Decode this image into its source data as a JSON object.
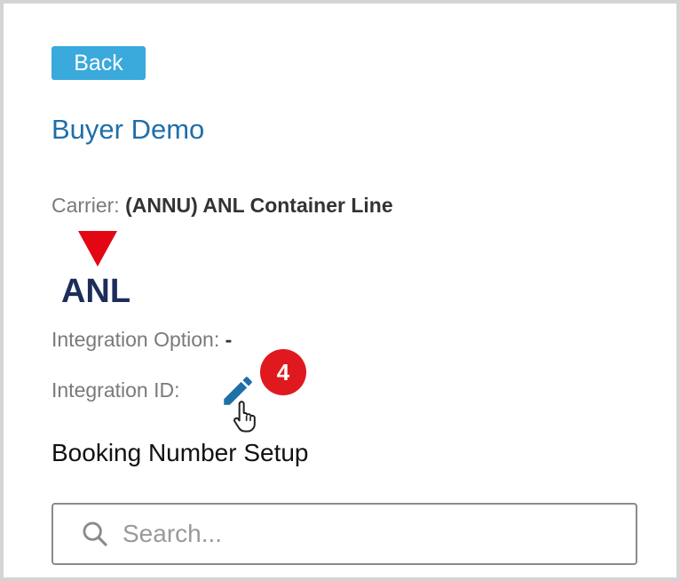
{
  "nav": {
    "back_label": "Back"
  },
  "header": {
    "title": "Buyer Demo"
  },
  "carrier": {
    "label": "Carrier:",
    "value": "(ANNU) ANL Container Line",
    "logo_text": "ANL"
  },
  "integration_option": {
    "label": "Integration Option:",
    "value": "-"
  },
  "integration_id": {
    "label": "Integration ID:",
    "step_badge": "4"
  },
  "booking_setup": {
    "title": "Booking Number Setup"
  },
  "search": {
    "placeholder": "Search..."
  },
  "colors": {
    "accent": "#3aa9dc",
    "title": "#1f6fa8",
    "badge": "#e0191f",
    "logo_red": "#e30613",
    "logo_navy": "#1c2d5a"
  },
  "icons": [
    "search-icon",
    "pencil-edit-icon",
    "hand-pointer-icon",
    "anl-logo"
  ]
}
